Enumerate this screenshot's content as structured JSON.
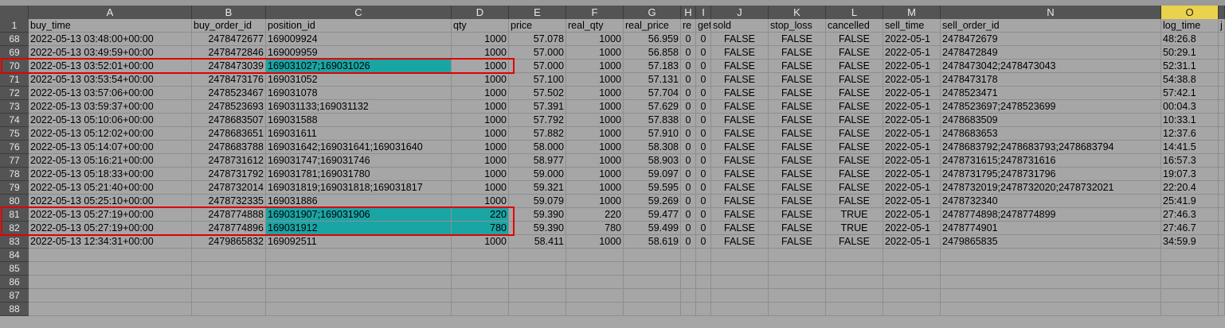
{
  "app": {
    "title": "Spreadsheet"
  },
  "columns": [
    {
      "letter": "A",
      "header": "buy_time"
    },
    {
      "letter": "B",
      "header": "buy_order_id"
    },
    {
      "letter": "C",
      "header": "position_id"
    },
    {
      "letter": "D",
      "header": "qty"
    },
    {
      "letter": "E",
      "header": "price"
    },
    {
      "letter": "F",
      "header": "real_qty"
    },
    {
      "letter": "G",
      "header": "real_price"
    },
    {
      "letter": "H",
      "header": "re"
    },
    {
      "letter": "I",
      "header": "get"
    },
    {
      "letter": "J",
      "header": "sold"
    },
    {
      "letter": "K",
      "header": "stop_loss"
    },
    {
      "letter": "L",
      "header": "cancelled"
    },
    {
      "letter": "M",
      "header": "sell_time"
    },
    {
      "letter": "N",
      "header": "sell_order_id"
    },
    {
      "letter": "O",
      "header": "log_time"
    },
    {
      "letter": "",
      "header": "j"
    }
  ],
  "selected_column": "O",
  "header_row_number": "1",
  "rows": [
    {
      "num": "68",
      "cells": [
        "2022-05-13 03:48:00+00:00",
        "2478472677",
        "169009924",
        "1000",
        "57.078",
        "1000",
        "56.959",
        "0",
        "0",
        "FALSE",
        "FALSE",
        "FALSE",
        "2022-05-1",
        "2478472679",
        "48:26.8",
        ""
      ]
    },
    {
      "num": "69",
      "cells": [
        "2022-05-13 03:49:59+00:00",
        "2478472846",
        "169009959",
        "1000",
        "57.000",
        "1000",
        "56.858",
        "0",
        "0",
        "FALSE",
        "FALSE",
        "FALSE",
        "2022-05-1",
        "2478472849",
        "50:29.1",
        ""
      ]
    },
    {
      "num": "70",
      "cells": [
        "2022-05-13 03:52:01+00:00",
        "2478473039",
        "169031027;169031026",
        "1000",
        "57.000",
        "1000",
        "57.183",
        "0",
        "0",
        "FALSE",
        "FALSE",
        "FALSE",
        "2022-05-1",
        "2478473042;2478473043",
        "52:31.1",
        ""
      ]
    },
    {
      "num": "71",
      "cells": [
        "2022-05-13 03:53:54+00:00",
        "2478473176",
        "169031052",
        "1000",
        "57.100",
        "1000",
        "57.131",
        "0",
        "0",
        "FALSE",
        "FALSE",
        "FALSE",
        "2022-05-1",
        "2478473178",
        "54:38.8",
        ""
      ]
    },
    {
      "num": "72",
      "cells": [
        "2022-05-13 03:57:06+00:00",
        "2478523467",
        "169031078",
        "1000",
        "57.502",
        "1000",
        "57.704",
        "0",
        "0",
        "FALSE",
        "FALSE",
        "FALSE",
        "2022-05-1",
        "2478523471",
        "57:42.1",
        ""
      ]
    },
    {
      "num": "73",
      "cells": [
        "2022-05-13 03:59:37+00:00",
        "2478523693",
        "169031133;169031132",
        "1000",
        "57.391",
        "1000",
        "57.629",
        "0",
        "0",
        "FALSE",
        "FALSE",
        "FALSE",
        "2022-05-1",
        "2478523697;2478523699",
        "00:04.3",
        ""
      ]
    },
    {
      "num": "74",
      "cells": [
        "2022-05-13 05:10:06+00:00",
        "2478683507",
        "169031588",
        "1000",
        "57.792",
        "1000",
        "57.838",
        "0",
        "0",
        "FALSE",
        "FALSE",
        "FALSE",
        "2022-05-1",
        "2478683509",
        "10:33.1",
        ""
      ]
    },
    {
      "num": "75",
      "cells": [
        "2022-05-13 05:12:02+00:00",
        "2478683651",
        "169031611",
        "1000",
        "57.882",
        "1000",
        "57.910",
        "0",
        "0",
        "FALSE",
        "FALSE",
        "FALSE",
        "2022-05-1",
        "2478683653",
        "12:37.6",
        ""
      ]
    },
    {
      "num": "76",
      "cells": [
        "2022-05-13 05:14:07+00:00",
        "2478683788",
        "169031642;169031641;169031640",
        "1000",
        "58.000",
        "1000",
        "58.308",
        "0",
        "0",
        "FALSE",
        "FALSE",
        "FALSE",
        "2022-05-1",
        "2478683792;2478683793;2478683794",
        "14:41.5",
        ""
      ]
    },
    {
      "num": "77",
      "cells": [
        "2022-05-13 05:16:21+00:00",
        "2478731612",
        "169031747;169031746",
        "1000",
        "58.977",
        "1000",
        "58.903",
        "0",
        "0",
        "FALSE",
        "FALSE",
        "FALSE",
        "2022-05-1",
        "2478731615;2478731616",
        "16:57.3",
        ""
      ]
    },
    {
      "num": "78",
      "cells": [
        "2022-05-13 05:18:33+00:00",
        "2478731792",
        "169031781;169031780",
        "1000",
        "59.000",
        "1000",
        "59.097",
        "0",
        "0",
        "FALSE",
        "FALSE",
        "FALSE",
        "2022-05-1",
        "2478731795;2478731796",
        "19:07.3",
        ""
      ]
    },
    {
      "num": "79",
      "cells": [
        "2022-05-13 05:21:40+00:00",
        "2478732014",
        "169031819;169031818;169031817",
        "1000",
        "59.321",
        "1000",
        "59.595",
        "0",
        "0",
        "FALSE",
        "FALSE",
        "FALSE",
        "2022-05-1",
        "2478732019;2478732020;2478732021",
        "22:20.4",
        ""
      ]
    },
    {
      "num": "80",
      "cells": [
        "2022-05-13 05:25:10+00:00",
        "2478732335",
        "169031886",
        "1000",
        "59.079",
        "1000",
        "59.269",
        "0",
        "0",
        "FALSE",
        "FALSE",
        "FALSE",
        "2022-05-1",
        "2478732340",
        "25:41.9",
        ""
      ]
    },
    {
      "num": "81",
      "cells": [
        "2022-05-13 05:27:19+00:00",
        "2478774888",
        "169031907;169031906",
        "220",
        "59.390",
        "220",
        "59.477",
        "0",
        "0",
        "FALSE",
        "FALSE",
        "TRUE",
        "2022-05-1",
        "2478774898;2478774899",
        "27:46.3",
        ""
      ]
    },
    {
      "num": "82",
      "cells": [
        "2022-05-13 05:27:19+00:00",
        "2478774896",
        "169031912",
        "780",
        "59.390",
        "780",
        "59.499",
        "0",
        "0",
        "FALSE",
        "FALSE",
        "TRUE",
        "2022-05-1",
        "2478774901",
        "27:46.7",
        ""
      ]
    },
    {
      "num": "83",
      "cells": [
        "2022-05-13 12:34:31+00:00",
        "2479865832",
        "169092511",
        "1000",
        "58.411",
        "1000",
        "58.619",
        "0",
        "0",
        "FALSE",
        "FALSE",
        "FALSE",
        "2022-05-1",
        "2479865835",
        "34:59.9",
        ""
      ]
    },
    {
      "num": "84",
      "cells": [
        "",
        "",
        "",
        "",
        "",
        "",
        "",
        "",
        "",
        "",
        "",
        "",
        "",
        "",
        "",
        ""
      ]
    },
    {
      "num": "85",
      "cells": [
        "",
        "",
        "",
        "",
        "",
        "",
        "",
        "",
        "",
        "",
        "",
        "",
        "",
        "",
        "",
        ""
      ]
    },
    {
      "num": "86",
      "cells": [
        "",
        "",
        "",
        "",
        "",
        "",
        "",
        "",
        "",
        "",
        "",
        "",
        "",
        "",
        "",
        ""
      ]
    },
    {
      "num": "87",
      "cells": [
        "",
        "",
        "",
        "",
        "",
        "",
        "",
        "",
        "",
        "",
        "",
        "",
        "",
        "",
        "",
        ""
      ]
    },
    {
      "num": "88",
      "cells": [
        "",
        "",
        "",
        "",
        "",
        "",
        "",
        "",
        "",
        "",
        "",
        "",
        "",
        "",
        "",
        ""
      ]
    }
  ],
  "highlighted_cells": [
    {
      "row": "70",
      "col": "C"
    },
    {
      "row": "81",
      "col": "C"
    },
    {
      "row": "81",
      "col": "D"
    },
    {
      "row": "82",
      "col": "C"
    },
    {
      "row": "82",
      "col": "D"
    }
  ],
  "highlight_color": "#1aa5a5",
  "selection_border_color": "#e00000",
  "outlined_ranges": [
    {
      "rows": [
        "70"
      ],
      "cols": [
        "A",
        "D"
      ]
    },
    {
      "rows": [
        "81",
        "82"
      ],
      "cols": [
        "A",
        "D"
      ]
    }
  ]
}
